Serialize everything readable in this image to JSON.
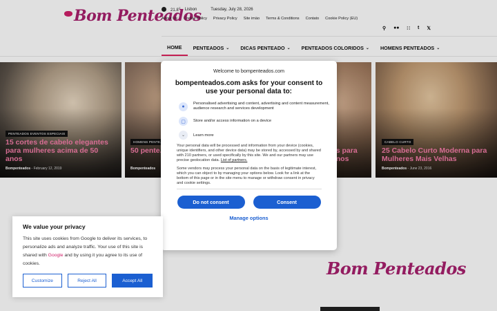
{
  "header": {
    "logo_text": "Bom Penteados",
    "weather_temp": "21.8",
    "weather_unit": "C",
    "weather_city": "Lisbon",
    "date": "Tuesday, July 28, 2026",
    "top_links": [
      "About Us",
      "Cookie Policy",
      "Privacy Policy",
      "Site imäo",
      "Terms & Conditions",
      "Contato",
      "Cookie Policy (EU)"
    ],
    "social_icons": [
      "search-icon",
      "flickr-icon",
      "rss-icon",
      "tumblr-icon",
      "twitter-icon"
    ],
    "nav": [
      {
        "label": "HOME",
        "active": true,
        "dropdown": false
      },
      {
        "label": "PENTEADOS",
        "active": false,
        "dropdown": true
      },
      {
        "label": "DICAS PENTEADO",
        "active": false,
        "dropdown": true
      },
      {
        "label": "PENTEADOS COLORIDOS",
        "active": false,
        "dropdown": true
      },
      {
        "label": "HOMENS PENTEADOS",
        "active": false,
        "dropdown": true
      }
    ]
  },
  "cards": [
    {
      "tag": "PENTEADOS EVENTOS ESPECIAIS",
      "title": "15 cortes de cabelo elegantes para mulheres acima de 50 anos",
      "author": "Bompenteados",
      "date": "February 12, 2019"
    },
    {
      "tag": "HOMENS PENTE...",
      "title": "50 pente... calvos",
      "author": "Bompenteados",
      "date": ""
    },
    {
      "tag": "",
      "title": "...s para ...nos",
      "author": "",
      "date": ""
    },
    {
      "tag": "CABELO CURTO",
      "title": "25 Cabelo Curto Moderna para Mulheres Mais Velhas",
      "author": "Bompenteados",
      "date": "June 23, 2016"
    }
  ],
  "consent": {
    "site": "Welcome to bompenteados.com",
    "heading": "bompenteados.com asks for your consent to use your personal data to:",
    "purposes": [
      {
        "icon": "person-icon",
        "text": "Personalised advertising and content, advertising and content measurement, audience research and services development"
      },
      {
        "icon": "device-icon",
        "text": "Store and/or access information on a device"
      }
    ],
    "learn_more": "Learn more",
    "body1": "Your personal data will be processed and information from your device (cookies, unique identifiers, and other device data) may be stored by, accessed by and shared with 210 partners, or used specifically by this site. We and our partners may use precise geolocation data.",
    "list_link": "List of partners.",
    "body2": "Some vendors may process your personal data on the basis of legitimate interest, which you can object to by managing your options below. Look for a link at the bottom of this page or in the site menu to manage or withdraw consent in privacy and cookie settings.",
    "btn_reject": "Do not consent",
    "btn_accept": "Consent",
    "manage": "Manage options"
  },
  "privacy": {
    "title": "We value your privacy",
    "text_before": "This site uses cookies from Google to deliver its services, to personalize ads and analyze traffic. Your use of this site is shared with ",
    "text_link": "Google",
    "text_after": " and by using it you agree to its use of cookies.",
    "customize": "Customize",
    "reject": "Reject All",
    "accept": "Accept All"
  },
  "footer_logo": "Bom Penteados",
  "colors": {
    "accent": "#e0245e",
    "brand": "#a8206e",
    "button": "#1b5fd1"
  }
}
